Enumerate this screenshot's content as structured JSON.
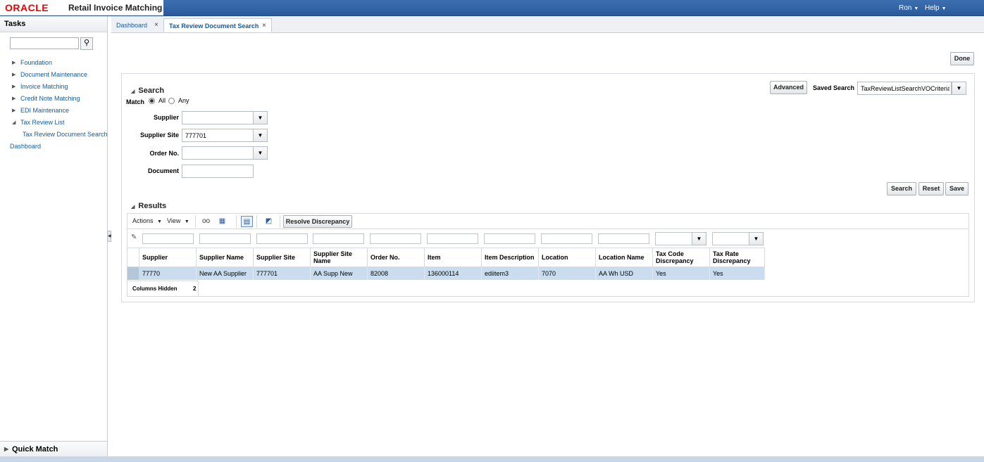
{
  "header": {
    "logo": "ORACLE",
    "app_title": "Retail Invoice Matching",
    "user": "Ron",
    "help": "Help"
  },
  "tasks": {
    "title": "Tasks",
    "search_placeholder": "",
    "items": [
      {
        "label": "Foundation",
        "expanded": false
      },
      {
        "label": "Document Maintenance",
        "expanded": false
      },
      {
        "label": "Invoice Matching",
        "expanded": false
      },
      {
        "label": "Credit Note Matching",
        "expanded": false
      },
      {
        "label": "EDI Maintenance",
        "expanded": false
      },
      {
        "label": "Tax Review List",
        "expanded": true
      },
      {
        "label": "Tax Review Document Search",
        "child": true
      },
      {
        "label": "Dashboard",
        "root": true
      }
    ],
    "quick_match": "Quick Match"
  },
  "tabs": [
    {
      "label": "Dashboard",
      "active": false
    },
    {
      "label": "Tax Review Document Search",
      "active": true
    }
  ],
  "actions": {
    "done": "Done"
  },
  "search": {
    "title": "Search",
    "match_label": "Match",
    "match_all": "All",
    "match_any": "Any",
    "advanced": "Advanced",
    "saved_search_label": "Saved Search",
    "saved_search_value": "TaxReviewListSearchVOCriteria",
    "fields": {
      "supplier": {
        "label": "Supplier",
        "value": ""
      },
      "supplier_site": {
        "label": "Supplier Site",
        "value": "777701"
      },
      "order_no": {
        "label": "Order No.",
        "value": ""
      },
      "document": {
        "label": "Document",
        "value": ""
      }
    },
    "search_btn": "Search",
    "reset_btn": "Reset",
    "save_btn": "Save"
  },
  "results": {
    "title": "Results",
    "actions_menu": "Actions",
    "view_menu": "View",
    "resolve_btn": "Resolve Discrepancy",
    "columns": [
      "Supplier",
      "Supplier Name",
      "Supplier Site",
      "Supplier Site Name",
      "Order No.",
      "Item",
      "Item Description",
      "Location",
      "Location Name",
      "Tax Code Discrepancy",
      "Tax Rate Discrepancy"
    ],
    "rows": [
      [
        "77770",
        "New AA Supplier",
        "777701",
        "AA Supp New",
        "82008",
        "136000114",
        "ediitem3",
        "7070",
        "AA Wh USD",
        "Yes",
        "Yes"
      ]
    ],
    "columns_hidden_label": "Columns Hidden",
    "columns_hidden_count": "2"
  }
}
